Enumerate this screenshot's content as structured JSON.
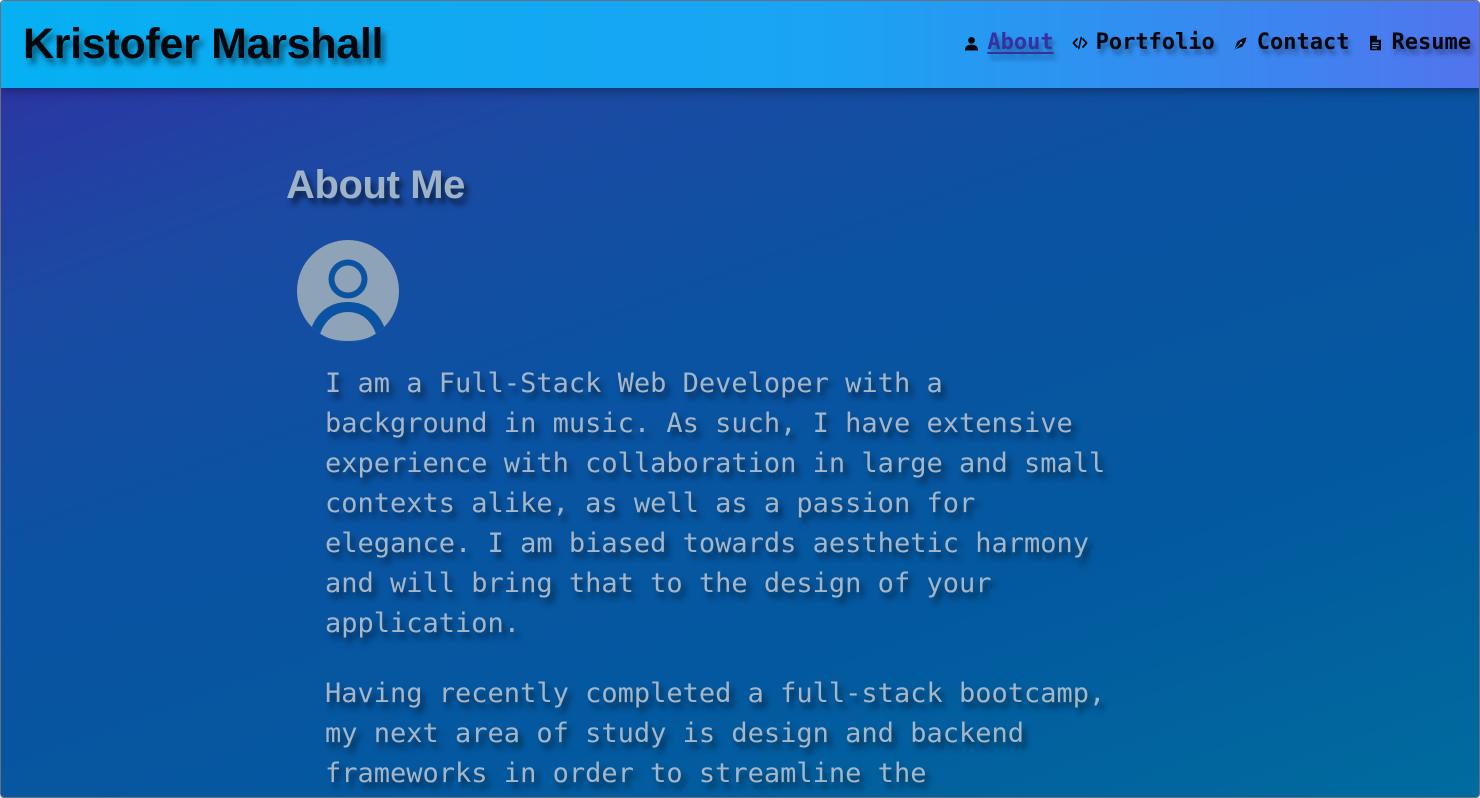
{
  "header": {
    "brand": "Kristofer Marshall",
    "nav": [
      {
        "label": "About",
        "icon": "user-icon",
        "active": true
      },
      {
        "label": "Portfolio",
        "icon": "code-icon",
        "active": false
      },
      {
        "label": "Contact",
        "icon": "pen-nib-icon",
        "active": false
      },
      {
        "label": "Resume",
        "icon": "file-icon",
        "active": false
      }
    ]
  },
  "about": {
    "title": "About Me",
    "avatar_icon": "user-circle-icon",
    "paragraphs": [
      "I am a Full-Stack Web Developer with a\nbackground in music. As such, I have extensive\nexperience with collaboration in large and small\ncontexts alike, as well as a passion for\nelegance. I am biased towards aesthetic harmony\nand will bring that to the design of your\napplication.",
      "Having recently completed a full-stack bootcamp,\nmy next area of study is design and backend\nframeworks in order to streamline the"
    ]
  },
  "colors": {
    "header_start": "#06b0f2",
    "header_end": "#5274ee",
    "body_start": "#2b36a4",
    "body_end": "#006c9e",
    "text_muted": "#a4b6c8",
    "active_nav": "#3730a3"
  }
}
